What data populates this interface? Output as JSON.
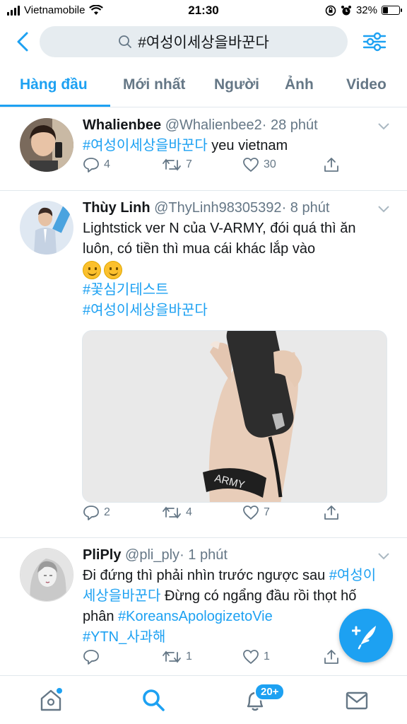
{
  "status_bar": {
    "carrier": "Vietnamobile",
    "time": "21:30",
    "battery_percent": "32%",
    "battery_level": 0.32
  },
  "header": {
    "search_query": "#여성이세상을바꾼다"
  },
  "tabs": [
    {
      "label": "Hàng đầu",
      "active": true
    },
    {
      "label": "Mới nhất",
      "active": false
    },
    {
      "label": "Người",
      "active": false
    },
    {
      "label": "Ảnh",
      "active": false
    },
    {
      "label": "Video",
      "active": false
    }
  ],
  "tweets": [
    {
      "name": "Whalienbee",
      "handle": "@Whalienbee2",
      "time": "· 28 phút",
      "hashtag1": "#여성이세상을바꾼다",
      "text1": " yeu vietnam",
      "replies": "4",
      "retweets": "7",
      "likes": "30"
    },
    {
      "name": "Thùy Linh",
      "handle": "@ThyLinh98305392",
      "time": "· 8 phút",
      "text1": "Lightstick ver N của V-ARMY, đói quá thì ăn luôn, có tiền thì mua cái khác lắp vào",
      "hashtag1": "#꽃심기테스트",
      "hashtag2": "#여성이세상을바꾼다",
      "media_text": "ARMY",
      "replies": "2",
      "retweets": "4",
      "likes": "7"
    },
    {
      "name": "PliPly",
      "handle": "@pli_ply",
      "time": "· 1 phút",
      "text1": "Đi đứng thì phải nhìn trước ngược sau ",
      "hashtag1": "#여성이세상을바꾼다",
      "text2": " Đừng có ngẩng đầu rồi thọt hố phân ",
      "hashtag2": "#KoreansApologizetoVie",
      "hashtag3": "#YTN_사과해",
      "replies": "",
      "retweets": "1",
      "likes": "1"
    }
  ],
  "bottom_nav": {
    "notifications_badge": "20+"
  },
  "colors": {
    "accent": "#1da1f2",
    "muted": "#657786",
    "divider": "#e1e8ed"
  }
}
